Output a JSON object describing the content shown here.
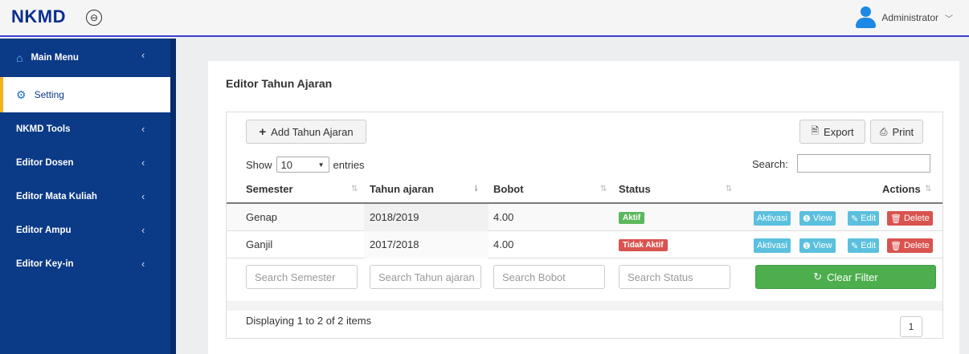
{
  "header": {
    "brand": "NKMD",
    "toggle_icon": "⊖",
    "user_name": "Administrator",
    "user_caret": "﹀"
  },
  "sidebar": {
    "items": [
      {
        "label": "Main Menu",
        "chev": "‹"
      },
      {
        "label": "Setting"
      },
      {
        "label": "NKMD Tools",
        "chev": "‹"
      },
      {
        "label": "Editor Dosen",
        "chev": "‹"
      },
      {
        "label": "Editor Mata Kuliah",
        "chev": "‹"
      },
      {
        "label": "Editor Ampu",
        "chev": "‹"
      },
      {
        "label": "Editor Key-in",
        "chev": "‹"
      }
    ]
  },
  "main": {
    "title": "Editor Tahun Ajaran",
    "add_button": "Add Tahun Ajaran",
    "export_button": "Export",
    "print_button": "Print",
    "show_label": "Show",
    "show_value": "10",
    "entries_label": "entries",
    "search_label": "Search:",
    "search_value": "",
    "columns": [
      "Semester",
      "Tahun ajaran",
      "Bobot",
      "Status",
      "Actions"
    ],
    "rows": [
      {
        "semester": "Genap",
        "tahun": "2018/2019",
        "bobot": "4.00",
        "status": "Aktif"
      },
      {
        "semester": "Ganjil",
        "tahun": "2017/2018",
        "bobot": "4.00",
        "status": "Tidak Aktif"
      }
    ],
    "actions": {
      "aktivasi": "Aktivasi",
      "view": "View",
      "edit": "Edit",
      "delete": "Delete"
    },
    "filters": {
      "semester_placeholder": "Search Semester",
      "tahun_placeholder": "Search Tahun ajaran",
      "bobot_placeholder": "Search Bobot",
      "status_placeholder": "Search Status",
      "clear_label": "Clear Filter"
    },
    "displaying": "Displaying 1 to 2 of 2 items",
    "page": "1"
  },
  "colors": {
    "brand": "#0a2f8c",
    "sidebar": "#0b3a87",
    "active_marker": "#f2b21c",
    "aktif": "#5cb85c",
    "tidak_aktif": "#d9534f",
    "info": "#5bc0de"
  }
}
